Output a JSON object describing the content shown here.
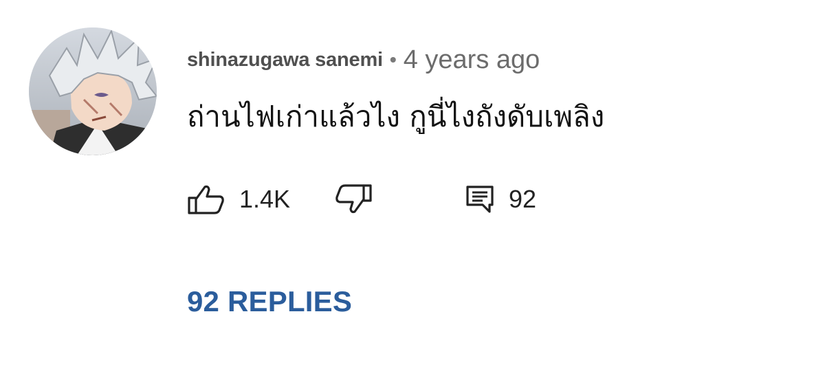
{
  "comment": {
    "author": "shinazugawa sanemi",
    "separator": "•",
    "time": "4 years ago",
    "text": "ถ่านไฟเก่าแล้วไง กูนี่ไงถังดับเพลิง"
  },
  "actions": {
    "like_count": "1.4K",
    "reply_count": "92"
  },
  "replies": {
    "label": "92 REPLIES"
  },
  "icons": {
    "like": "thumbs-up-icon",
    "dislike": "thumbs-down-icon",
    "reply": "comment-icon"
  },
  "colors": {
    "replies_link": "#2b5d9c",
    "author": "#505050",
    "time": "#6c6c6c"
  }
}
